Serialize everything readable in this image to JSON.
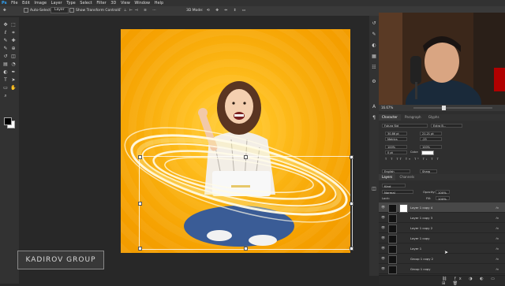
{
  "menu": [
    "Ps",
    "File",
    "Edit",
    "Image",
    "Layer",
    "Type",
    "Select",
    "Filter",
    "3D",
    "View",
    "Window",
    "Help"
  ],
  "options": {
    "auto_select_label": "Auto-Select:",
    "auto_select_value": "Layer",
    "show_transform_label": "Show Transform Controls",
    "mode_label": "3D Mode:"
  },
  "tools_left": [
    "move-icon",
    "marquee-icon",
    "lasso-icon",
    "crop-icon",
    "eyedropper-icon",
    "healing-icon",
    "brush-icon",
    "stamp-icon",
    "history-brush-icon",
    "eraser-icon",
    "gradient-icon",
    "blur-icon",
    "dodge-icon",
    "pen-icon",
    "type-icon",
    "path-selection-icon",
    "shape-icon",
    "hand-icon",
    "zoom-icon"
  ],
  "tool_glyphs": [
    "✥",
    "⬚",
    "ℓ",
    "⌗",
    "✎",
    "✚",
    "✎",
    "⊕",
    "↺",
    "◫",
    "▤",
    "◔",
    "◐",
    "✒",
    "T",
    "➤",
    "▭",
    "✋",
    "⌕"
  ],
  "watermark": "KADIROV GROUP",
  "navigator": {
    "zoom": "16.67%"
  },
  "panel_tabs": {
    "character": "Character",
    "paragraph": "Paragraph",
    "glyphs": "Glyphs"
  },
  "character": {
    "font_family": "Futura Std",
    "font_style": "Extra B...",
    "font_size": "30.86 pt",
    "leading": "21.21 pt",
    "kerning": "Metrics",
    "tracking": "-25",
    "vertical_scale": "100%",
    "horizontal_scale": "100%",
    "baseline": "0 pt",
    "color_label": "Color:",
    "language": "English",
    "antialias": "Sharp"
  },
  "layers_tabs": {
    "layers": "Layers",
    "channels": "Channels"
  },
  "layers_panel": {
    "kind": "Kind",
    "blend_mode": "Normal",
    "opacity_label": "Opacity:",
    "opacity": "100%",
    "lock_label": "Lock:",
    "fill_label": "Fill:",
    "fill": "100%"
  },
  "layers": [
    {
      "name": "Layer 1 copy 4",
      "active": true
    },
    {
      "name": "Layer 1 copy 3",
      "active": false
    },
    {
      "name": "Layer 1 copy 2",
      "active": false
    },
    {
      "name": "Layer 1 copy",
      "active": false
    },
    {
      "name": "Layer 1",
      "active": false
    },
    {
      "name": "Group 1 copy 2",
      "active": false
    },
    {
      "name": "Group 1 copy",
      "active": false
    }
  ],
  "colors": {
    "canvas_orange": "#f5a000",
    "fg": "#000000",
    "bg": "#ffffff",
    "ui_dark": "#282828"
  }
}
